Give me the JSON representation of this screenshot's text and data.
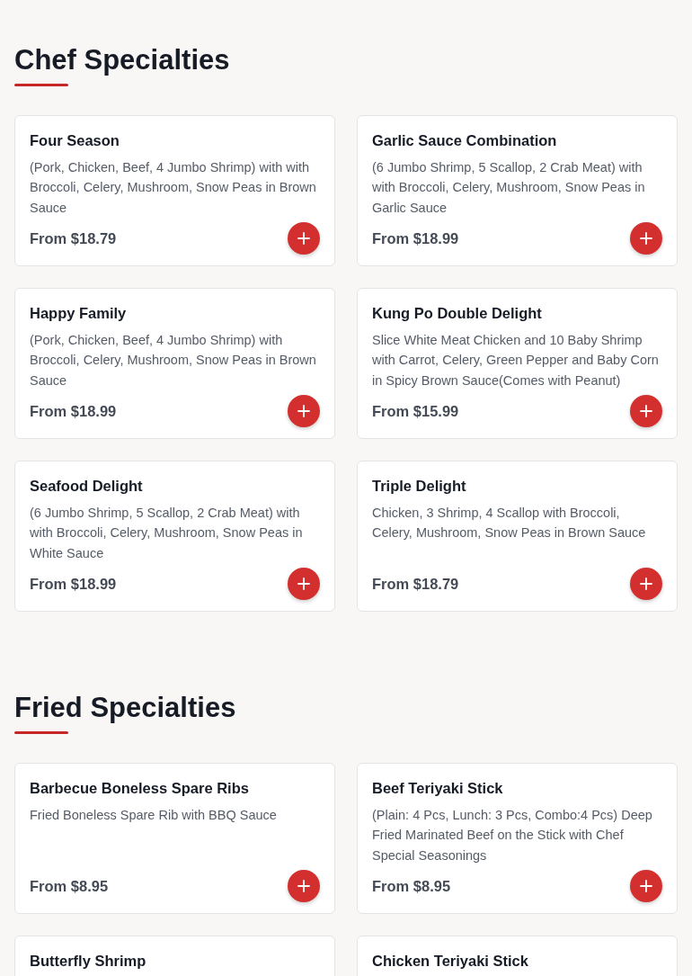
{
  "sections": [
    {
      "title": "Chef Specialties",
      "items": [
        {
          "name": "Four Season",
          "description": "(Pork, Chicken, Beef, 4 Jumbo Shrimp) with with Broccoli, Celery, Mushroom, Snow Peas in Brown Sauce",
          "price": "From $18.79"
        },
        {
          "name": "Garlic Sauce Combination",
          "description": "(6 Jumbo Shrimp, 5 Scallop, 2 Crab Meat) with with Broccoli, Celery, Mushroom, Snow Peas in Garlic Sauce",
          "price": "From $18.99"
        },
        {
          "name": "Happy Family",
          "description": "(Pork, Chicken, Beef, 4 Jumbo Shrimp) with Broccoli, Celery, Mushroom, Snow Peas in Brown Sauce",
          "price": "From $18.99"
        },
        {
          "name": "Kung Po Double Delight",
          "description": "Slice White Meat Chicken and 10 Baby Shrimp with Carrot, Celery, Green Pepper and Baby Corn in Spicy Brown Sauce(Comes with Peanut)",
          "price": "From $15.99"
        },
        {
          "name": "Seafood Delight",
          "description": "(6 Jumbo Shrimp, 5 Scallop, 2 Crab Meat) with with Broccoli, Celery, Mushroom, Snow Peas in White Sauce",
          "price": "From $18.99"
        },
        {
          "name": "Triple Delight",
          "description": "Chicken, 3 Shrimp, 4 Scallop with Broccoli, Celery, Mushroom, Snow Peas in Brown Sauce",
          "price": "From $18.79"
        }
      ]
    },
    {
      "title": "Fried Specialties",
      "items": [
        {
          "name": "Barbecue Boneless Spare Ribs",
          "description": "Fried Boneless Spare Rib with BBQ Sauce",
          "price": "From $8.95"
        },
        {
          "name": "Beef Teriyaki Stick",
          "description": "(Plain: 4 Pcs, Lunch: 3 Pcs, Combo:4 Pcs) Deep Fried Marinated Beef on the Stick with Chef Special Seasonings",
          "price": "From $8.95"
        },
        {
          "name": "Butterfly Shrimp"
        },
        {
          "name": "Chicken Teriyaki Stick"
        }
      ]
    }
  ]
}
